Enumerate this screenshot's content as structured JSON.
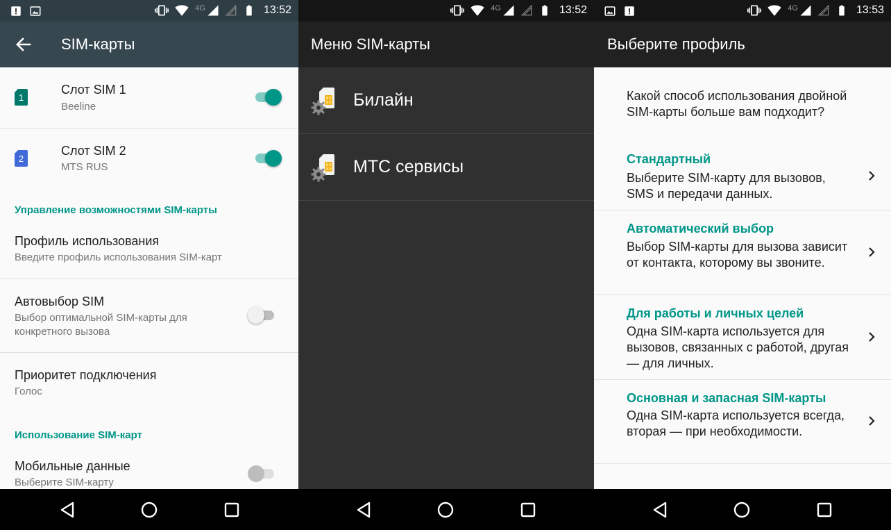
{
  "status_time": [
    "13:52",
    "13:52",
    "13:53"
  ],
  "network_type": "4G",
  "screen1": {
    "title": "SIM-карты",
    "slot1": {
      "badge": "1",
      "label": "Слот SIM 1",
      "operator": "Beeline",
      "enabled": true
    },
    "slot2": {
      "badge": "2",
      "label": "Слот SIM 2",
      "operator": "MTS RUS",
      "enabled": true
    },
    "section_manage": "Управление возможностями SIM-карты",
    "profile": {
      "label": "Профиль использования",
      "summary": "Введите профиль использования SIM-карт"
    },
    "autoselect": {
      "label": "Автовыбор SIM",
      "summary": "Выбор оптимальной SIM-карты для конкретного вызова",
      "enabled": false
    },
    "priority": {
      "label": "Приоритет подключения",
      "summary": "Голос"
    },
    "section_usage": "Использование SIM-карт",
    "mobile_data": {
      "label": "Мобильные данные",
      "summary": "Выберите SIM-карту"
    }
  },
  "screen2": {
    "title": "Меню SIM-карты",
    "items": [
      {
        "label": "Билайн"
      },
      {
        "label": "МТС сервисы"
      }
    ]
  },
  "screen3": {
    "title": "Выберите профиль",
    "question": "Какой способ использования двойной SIM-карты больше вам подходит?",
    "options": [
      {
        "title": "Стандартный",
        "desc": "Выберите SIM-карту для вызовов, SMS и передачи данных."
      },
      {
        "title": "Автоматический выбор",
        "desc": "Выбор SIM-карты для вызова зависит от контакта, которому вы звоните."
      },
      {
        "title": "Для работы и личных целей",
        "desc": "Одна SIM-карта используется для вызовов, связанных с работой, другая — для личных."
      },
      {
        "title": "Основная и запасная SIM-карты",
        "desc": "Одна SIM-карта используется всегда, вторая — при необходимости."
      }
    ]
  },
  "colors": {
    "accent": "#009688",
    "sim1": "#00796b",
    "sim2": "#3f6ad8",
    "appbar_settings": "#37474f",
    "appbar_dark": "#212121"
  },
  "icons": [
    "back-arrow-icon",
    "sim-card-icon",
    "sim-toolkit-icon",
    "chevron-right-icon",
    "nav-back-icon",
    "nav-home-icon",
    "nav-recents-icon"
  ]
}
